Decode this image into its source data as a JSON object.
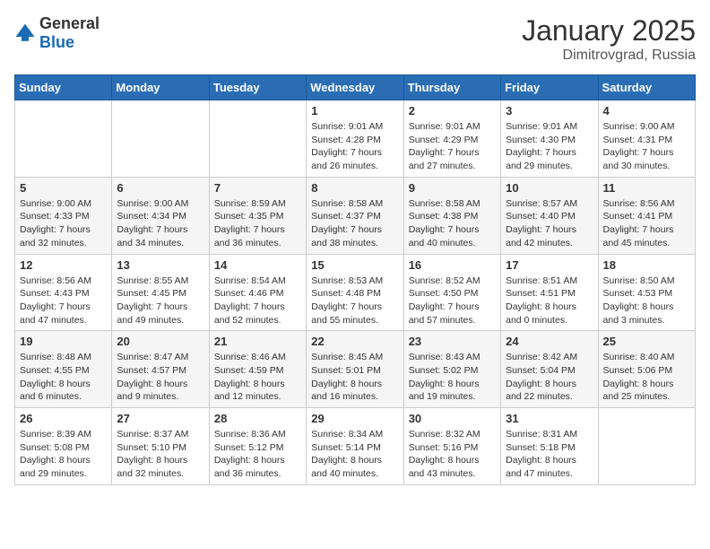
{
  "header": {
    "logo_general": "General",
    "logo_blue": "Blue",
    "month": "January 2025",
    "location": "Dimitrovgrad, Russia"
  },
  "weekdays": [
    "Sunday",
    "Monday",
    "Tuesday",
    "Wednesday",
    "Thursday",
    "Friday",
    "Saturday"
  ],
  "weeks": [
    [
      {
        "day": "",
        "info": ""
      },
      {
        "day": "",
        "info": ""
      },
      {
        "day": "",
        "info": ""
      },
      {
        "day": "1",
        "info": "Sunrise: 9:01 AM\nSunset: 4:28 PM\nDaylight: 7 hours and 26 minutes."
      },
      {
        "day": "2",
        "info": "Sunrise: 9:01 AM\nSunset: 4:29 PM\nDaylight: 7 hours and 27 minutes."
      },
      {
        "day": "3",
        "info": "Sunrise: 9:01 AM\nSunset: 4:30 PM\nDaylight: 7 hours and 29 minutes."
      },
      {
        "day": "4",
        "info": "Sunrise: 9:00 AM\nSunset: 4:31 PM\nDaylight: 7 hours and 30 minutes."
      }
    ],
    [
      {
        "day": "5",
        "info": "Sunrise: 9:00 AM\nSunset: 4:33 PM\nDaylight: 7 hours and 32 minutes."
      },
      {
        "day": "6",
        "info": "Sunrise: 9:00 AM\nSunset: 4:34 PM\nDaylight: 7 hours and 34 minutes."
      },
      {
        "day": "7",
        "info": "Sunrise: 8:59 AM\nSunset: 4:35 PM\nDaylight: 7 hours and 36 minutes."
      },
      {
        "day": "8",
        "info": "Sunrise: 8:58 AM\nSunset: 4:37 PM\nDaylight: 7 hours and 38 minutes."
      },
      {
        "day": "9",
        "info": "Sunrise: 8:58 AM\nSunset: 4:38 PM\nDaylight: 7 hours and 40 minutes."
      },
      {
        "day": "10",
        "info": "Sunrise: 8:57 AM\nSunset: 4:40 PM\nDaylight: 7 hours and 42 minutes."
      },
      {
        "day": "11",
        "info": "Sunrise: 8:56 AM\nSunset: 4:41 PM\nDaylight: 7 hours and 45 minutes."
      }
    ],
    [
      {
        "day": "12",
        "info": "Sunrise: 8:56 AM\nSunset: 4:43 PM\nDaylight: 7 hours and 47 minutes."
      },
      {
        "day": "13",
        "info": "Sunrise: 8:55 AM\nSunset: 4:45 PM\nDaylight: 7 hours and 49 minutes."
      },
      {
        "day": "14",
        "info": "Sunrise: 8:54 AM\nSunset: 4:46 PM\nDaylight: 7 hours and 52 minutes."
      },
      {
        "day": "15",
        "info": "Sunrise: 8:53 AM\nSunset: 4:48 PM\nDaylight: 7 hours and 55 minutes."
      },
      {
        "day": "16",
        "info": "Sunrise: 8:52 AM\nSunset: 4:50 PM\nDaylight: 7 hours and 57 minutes."
      },
      {
        "day": "17",
        "info": "Sunrise: 8:51 AM\nSunset: 4:51 PM\nDaylight: 8 hours and 0 minutes."
      },
      {
        "day": "18",
        "info": "Sunrise: 8:50 AM\nSunset: 4:53 PM\nDaylight: 8 hours and 3 minutes."
      }
    ],
    [
      {
        "day": "19",
        "info": "Sunrise: 8:48 AM\nSunset: 4:55 PM\nDaylight: 8 hours and 6 minutes."
      },
      {
        "day": "20",
        "info": "Sunrise: 8:47 AM\nSunset: 4:57 PM\nDaylight: 8 hours and 9 minutes."
      },
      {
        "day": "21",
        "info": "Sunrise: 8:46 AM\nSunset: 4:59 PM\nDaylight: 8 hours and 12 minutes."
      },
      {
        "day": "22",
        "info": "Sunrise: 8:45 AM\nSunset: 5:01 PM\nDaylight: 8 hours and 16 minutes."
      },
      {
        "day": "23",
        "info": "Sunrise: 8:43 AM\nSunset: 5:02 PM\nDaylight: 8 hours and 19 minutes."
      },
      {
        "day": "24",
        "info": "Sunrise: 8:42 AM\nSunset: 5:04 PM\nDaylight: 8 hours and 22 minutes."
      },
      {
        "day": "25",
        "info": "Sunrise: 8:40 AM\nSunset: 5:06 PM\nDaylight: 8 hours and 25 minutes."
      }
    ],
    [
      {
        "day": "26",
        "info": "Sunrise: 8:39 AM\nSunset: 5:08 PM\nDaylight: 8 hours and 29 minutes."
      },
      {
        "day": "27",
        "info": "Sunrise: 8:37 AM\nSunset: 5:10 PM\nDaylight: 8 hours and 32 minutes."
      },
      {
        "day": "28",
        "info": "Sunrise: 8:36 AM\nSunset: 5:12 PM\nDaylight: 8 hours and 36 minutes."
      },
      {
        "day": "29",
        "info": "Sunrise: 8:34 AM\nSunset: 5:14 PM\nDaylight: 8 hours and 40 minutes."
      },
      {
        "day": "30",
        "info": "Sunrise: 8:32 AM\nSunset: 5:16 PM\nDaylight: 8 hours and 43 minutes."
      },
      {
        "day": "31",
        "info": "Sunrise: 8:31 AM\nSunset: 5:18 PM\nDaylight: 8 hours and 47 minutes."
      },
      {
        "day": "",
        "info": ""
      }
    ]
  ]
}
